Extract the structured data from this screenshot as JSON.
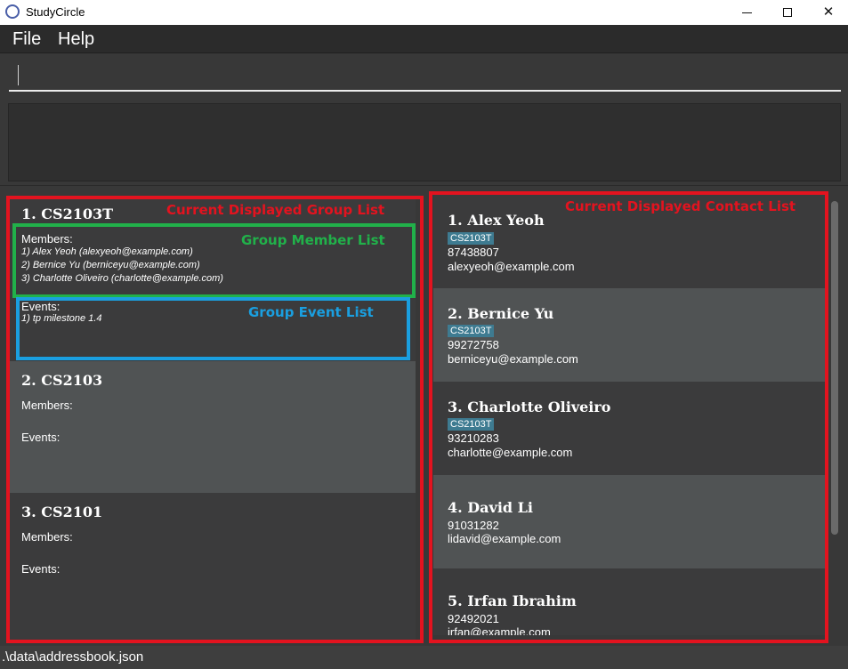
{
  "window": {
    "title": "StudyCircle",
    "minimize_icon": "minimize-icon",
    "maximize_icon": "maximize-icon",
    "close_glyph": "✕"
  },
  "menu": {
    "file_label": "File",
    "help_label": "Help"
  },
  "command": {
    "value": "",
    "result_text": ""
  },
  "groups": [
    {
      "name": "1. CS2103T",
      "members_label": "Members:",
      "members": [
        "1) Alex Yeoh (alexyeoh@example.com)",
        "2) Bernice Yu (berniceyu@example.com)",
        "3) Charlotte Oliveiro (charlotte@example.com)"
      ],
      "events_label": "Events:",
      "events": [
        "1) tp milestone 1.4"
      ]
    },
    {
      "name": "2. CS2103",
      "members_label": "Members:",
      "members": [],
      "events_label": "Events:",
      "events": []
    },
    {
      "name": "3. CS2101",
      "members_label": "Members:",
      "members": [],
      "events_label": "Events:",
      "events": []
    }
  ],
  "contacts": [
    {
      "name": "1. Alex Yeoh",
      "tag": "CS2103T",
      "phone": "87438807",
      "email": "alexyeoh@example.com"
    },
    {
      "name": "2. Bernice Yu",
      "tag": "CS2103T",
      "phone": "99272758",
      "email": "berniceyu@example.com"
    },
    {
      "name": "3. Charlotte Oliveiro",
      "tag": "CS2103T",
      "phone": "93210283",
      "email": "charlotte@example.com"
    },
    {
      "name": "4. David Li",
      "tag": null,
      "phone": "91031282",
      "email": "lidavid@example.com"
    },
    {
      "name": "5. Irfan Ibrahim",
      "tag": null,
      "phone": "92492021",
      "email": "irfan@example.com"
    }
  ],
  "annotations": {
    "group_list": "Current Displayed Group List",
    "group_member_list": "Group Member List",
    "group_event_list": "Group Event List",
    "contact_list": "Current Displayed Contact List",
    "colors": {
      "red": "#e3131f",
      "green": "#21b14a",
      "blue": "#1a9fe0"
    }
  },
  "status": {
    "path": ".\\data\\addressbook.json"
  },
  "colors": {
    "background": "#383838",
    "card_dark": "#3b3b3c",
    "card_light": "#505354",
    "tag": "#3e7b91"
  }
}
